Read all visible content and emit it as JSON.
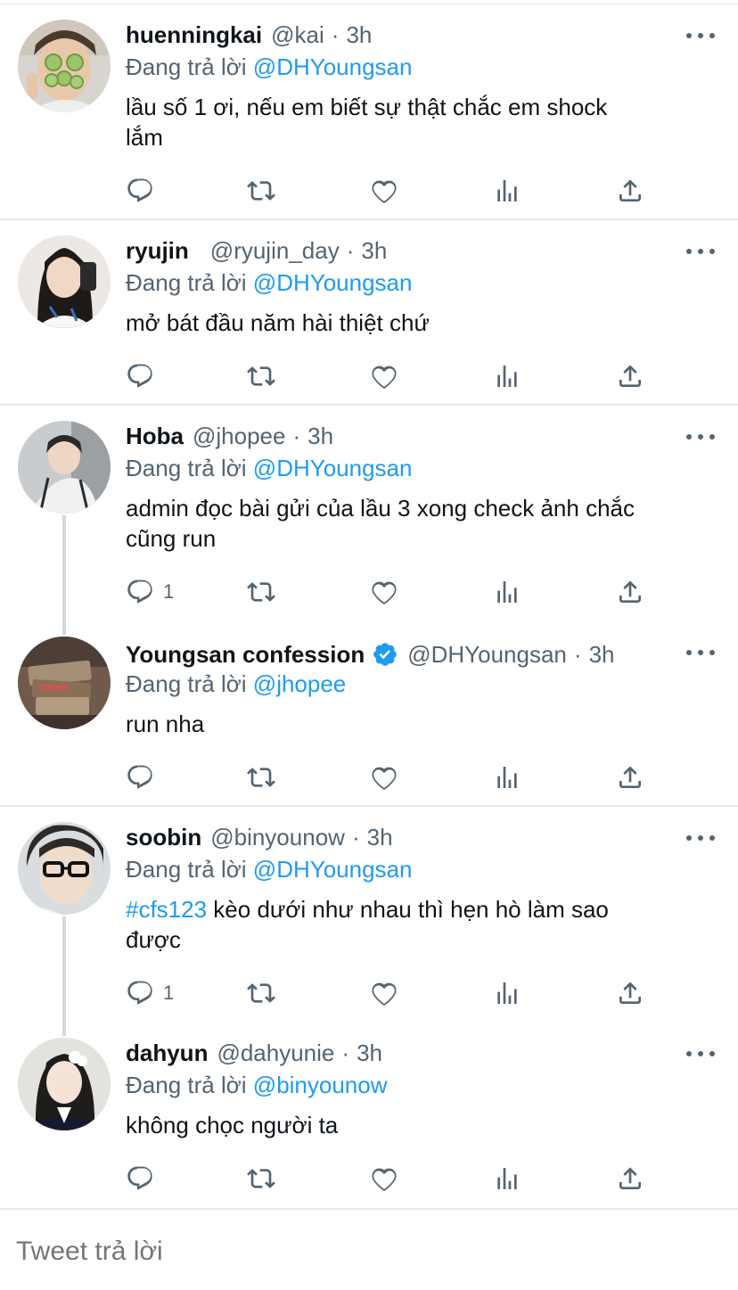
{
  "replying_label": "Đang trả lời",
  "tweets": [
    {
      "name": "huenningkai",
      "handle": "@kai",
      "sep": "·",
      "time": "3h",
      "reply_to": "@DHYoungsan",
      "line1": "lầu số 1 ơi, nếu em biết sự thật chắc em shock",
      "line2": "lắm",
      "reply_count": ""
    },
    {
      "name": "ryujin",
      "handle": "@ryujin_day",
      "sep": "·",
      "time": "3h",
      "reply_to": "@DHYoungsan",
      "line1": "mở bát đầu năm hài thiệt chứ",
      "reply_count": ""
    },
    {
      "name": "Hoba",
      "handle": "@jhopee",
      "sep": "·",
      "time": "3h",
      "reply_to": "@DHYoungsan",
      "line1": "admin đọc bài gửi của lầu 3 xong check ảnh chắc",
      "line2": "cũng run",
      "reply_count": "1"
    },
    {
      "name": "Youngsan confession",
      "handle": "@DHYoungsan",
      "sep": "·",
      "time": "3h",
      "reply_to": "@jhopee",
      "line1": "run nha",
      "reply_count": "",
      "verified": true
    },
    {
      "name": "soobin",
      "handle": "@binyounow",
      "sep": "·",
      "time": "3h",
      "reply_to": "@DHYoungsan",
      "hashtag": "#cfs123",
      "line1_rest": " kèo dưới như nhau thì hẹn hò làm sao",
      "line2": "được",
      "reply_count": "1"
    },
    {
      "name": "dahyun",
      "handle": "@dahyunie",
      "sep": "·",
      "time": "3h",
      "reply_to": "@binyounow",
      "line1": "không chọc người ta",
      "reply_count": ""
    }
  ],
  "composer": {
    "placeholder": "Tweet trả lời"
  },
  "colors": {
    "accent": "#1d9bf0",
    "muted": "#536471",
    "divider": "#e7e9ea"
  },
  "icons": [
    "reply-icon",
    "retweet-icon",
    "like-icon",
    "view-stats-icon",
    "share-icon",
    "more-options-icon",
    "verified-badge-icon"
  ]
}
